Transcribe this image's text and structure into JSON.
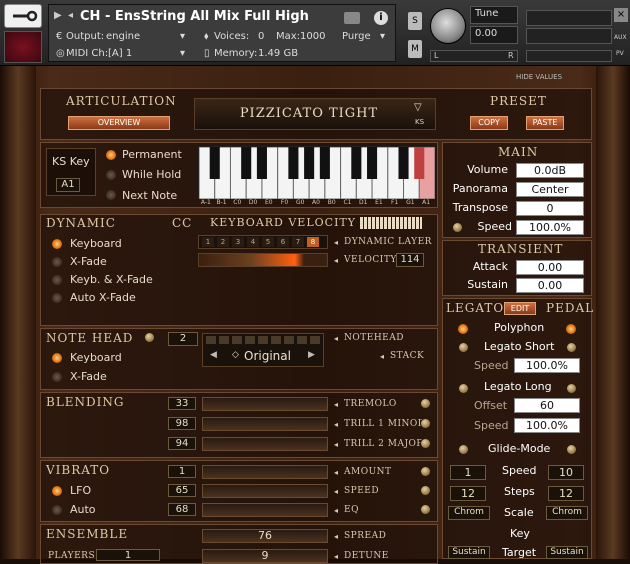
{
  "instrument": {
    "title": "CH - EnsString All Mix Full High",
    "output_label": "Output:",
    "output_value": "engine",
    "voices_label": "Voices:",
    "voices_value": "0",
    "max_label": "Max:",
    "max_value": "1000",
    "purge_label": "Purge",
    "midi_label": "MIDI Ch:",
    "midi_value": "[A]  1",
    "memory_label": "Memory:",
    "memory_value": "1.49 GB",
    "solo": "S",
    "mute": "M",
    "tune_label": "Tune",
    "tune_value": "0.00",
    "pan_l": "L",
    "pan_r": "R",
    "aux": "AUX",
    "pv": "PV"
  },
  "hide_values": "HIDE VALUES",
  "articulation": {
    "header": "ARTICULATION",
    "overview": "OVERVIEW",
    "current": "PIZZICATO TIGHT",
    "ks": "KS"
  },
  "preset": {
    "header": "PRESET",
    "copy": "COPY",
    "paste": "PASTE"
  },
  "keyswitch": {
    "label": "KS Key",
    "value": "A1",
    "modes": [
      "Permanent",
      "While Hold",
      "Next Note"
    ],
    "keys": [
      "A-1",
      "B-1",
      "C0",
      "D0",
      "E0",
      "F0",
      "G0",
      "A0",
      "B0",
      "C1",
      "D1",
      "E1",
      "F1",
      "G1",
      "A1"
    ]
  },
  "main": {
    "header": "MAIN",
    "rows": [
      {
        "label": "Volume",
        "value": "0.0dB"
      },
      {
        "label": "Panorama",
        "value": "Center"
      },
      {
        "label": "Transpose",
        "value": "0"
      },
      {
        "label": "Speed",
        "value": "100.0%"
      }
    ]
  },
  "transient": {
    "header": "TRANSIENT",
    "rows": [
      {
        "label": "Attack",
        "value": "0.00"
      },
      {
        "label": "Sustain",
        "value": "0.00"
      }
    ]
  },
  "dynamic": {
    "header": "DYNAMIC",
    "cc": "CC",
    "kv_header": "KEYBOARD VELOCITY",
    "options": [
      "Keyboard",
      "X-Fade",
      "Keyb. & X-Fade",
      "Auto X-Fade"
    ],
    "layers": [
      "1",
      "2",
      "3",
      "4",
      "5",
      "6",
      "7",
      "8"
    ],
    "dyn_layer_label": "DYNAMIC LAYER",
    "velocity_label": "VELOCITY",
    "velocity_value": "114"
  },
  "notehead": {
    "header": "NOTE HEAD",
    "count": "2",
    "options": [
      "Keyboard",
      "X-Fade"
    ],
    "value": "Original",
    "notehead_label": "NOTEHEAD",
    "stack_label": "STACK"
  },
  "blending": {
    "header": "BLENDING",
    "rows": [
      {
        "value": "33",
        "label": "TREMOLO"
      },
      {
        "value": "98",
        "label": "TRILL 1 MINOR"
      },
      {
        "value": "94",
        "label": "TRILL 2 MAJOR"
      }
    ]
  },
  "vibrato": {
    "header": "VIBRATO",
    "rows": [
      {
        "led": "",
        "value": "1",
        "label": "AMOUNT"
      },
      {
        "led": "LFO",
        "value": "65",
        "label": "SPEED"
      },
      {
        "led": "Auto",
        "value": "68",
        "label": "EQ"
      }
    ]
  },
  "ensemble": {
    "header": "ENSEMBLE",
    "spread_value": "76",
    "spread_label": "SPREAD",
    "players_label": "PLAYERS",
    "players_value": "1",
    "detune_value": "9",
    "detune_label": "DETUNE"
  },
  "legato": {
    "header": "LEGATO",
    "edit": "EDIT",
    "pedal": "PEDAL",
    "polyphon": "Polyphon",
    "legato_short": "Legato Short",
    "short_speed_label": "Speed",
    "short_speed": "100.0%",
    "legato_long": "Legato Long",
    "offset_label": "Offset",
    "offset_value": "60",
    "long_speed_label": "Speed",
    "long_speed": "100.0%",
    "glide_mode": "Glide-Mode",
    "speed_label": "Speed",
    "speed_l": "1",
    "speed_r": "10",
    "steps_label": "Steps",
    "steps_l": "12",
    "steps_r": "12",
    "scale_label": "Scale",
    "scale_l": "Chrom",
    "scale_r": "Chrom",
    "key_label": "Key",
    "target_label": "Target",
    "target_l": "Sustain",
    "target_r": "Sustain"
  }
}
